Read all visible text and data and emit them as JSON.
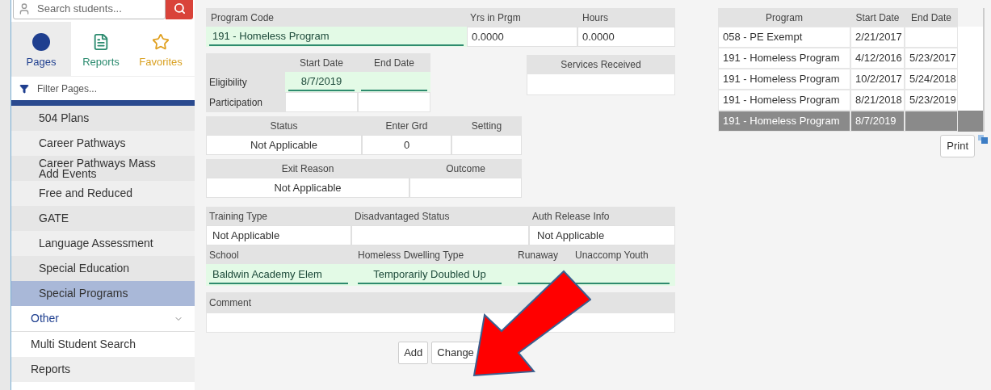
{
  "sidebar": {
    "search": {
      "placeholder": "Search students..."
    },
    "tabs": [
      {
        "label": "Pages",
        "selected": true,
        "kind": "dot"
      },
      {
        "label": "Reports",
        "selected": false,
        "kind": "doc"
      },
      {
        "label": "Favorites",
        "selected": false,
        "kind": "star"
      }
    ],
    "filter": {
      "placeholder": "Filter Pages..."
    },
    "pages": [
      {
        "label": "504 Plans",
        "selected": false
      },
      {
        "label": "Career Pathways",
        "selected": false
      },
      {
        "label": "Career Pathways Mass Add Events",
        "selected": false
      },
      {
        "label": "Free and Reduced",
        "selected": false
      },
      {
        "label": "GATE",
        "selected": false
      },
      {
        "label": "Language Assessment",
        "selected": false
      },
      {
        "label": "Special Education",
        "selected": false
      },
      {
        "label": "Special Programs",
        "selected": true
      }
    ],
    "section": {
      "label": "Other",
      "expanded": false
    },
    "links": [
      "Multi Student Search",
      "Reports"
    ]
  },
  "form": {
    "program": [
      {
        "label": "Program Code",
        "value": "191 - Homeless Program"
      },
      {
        "label": "Yrs in Prgm",
        "value": "0.0000"
      },
      {
        "label": "Hours",
        "value": "0.0000"
      }
    ],
    "dates": {
      "columns": [
        "Start Date",
        "End Date"
      ],
      "rows": [
        {
          "label": "Eligibility",
          "start": "8/7/2019",
          "editable": true
        },
        {
          "label": "Participation",
          "editable": false
        }
      ]
    },
    "services": {
      "label": "Services Received"
    },
    "status": [
      {
        "label": "Status",
        "value": "Not Applicable"
      },
      {
        "label": "Enter Grd",
        "value": "0"
      },
      {
        "label": "Setting"
      }
    ],
    "exit": [
      {
        "label": "Exit Reason",
        "value": "Not Applicable"
      },
      {
        "label": "Outcome"
      }
    ],
    "training": [
      {
        "label": "Training Type",
        "value": "Not Applicable"
      },
      {
        "label": "Disadvantaged Status"
      },
      {
        "label": "Auth Release Info",
        "value": "Not Applicable"
      }
    ],
    "school": {
      "columns": [
        "School",
        "Homeless Dwelling Type",
        "Runaway",
        "Unaccomp Youth"
      ],
      "school": "Baldwin Academy Elem",
      "dwelling": "Temporarily Doubled Up"
    },
    "comment": {
      "label": "Comment"
    },
    "buttons": [
      "Add",
      "Change"
    ]
  },
  "history": {
    "columns": [
      "Program",
      "Start Date",
      "End Date"
    ],
    "rows": [
      {
        "program": "058 - PE Exempt",
        "start": "2/21/2017",
        "selected": false
      },
      {
        "program": "191 - Homeless Program",
        "start": "4/12/2016",
        "end": "5/23/2017",
        "selected": false
      },
      {
        "program": "191 - Homeless Program",
        "start": "10/2/2017",
        "end": "5/24/2018",
        "selected": false
      },
      {
        "program": "191 - Homeless Program",
        "start": "8/21/2018",
        "end": "5/23/2019",
        "selected": false
      },
      {
        "program": "191 - Homeless Program",
        "start": "8/7/2019",
        "selected": true
      }
    ],
    "print": "Print"
  }
}
